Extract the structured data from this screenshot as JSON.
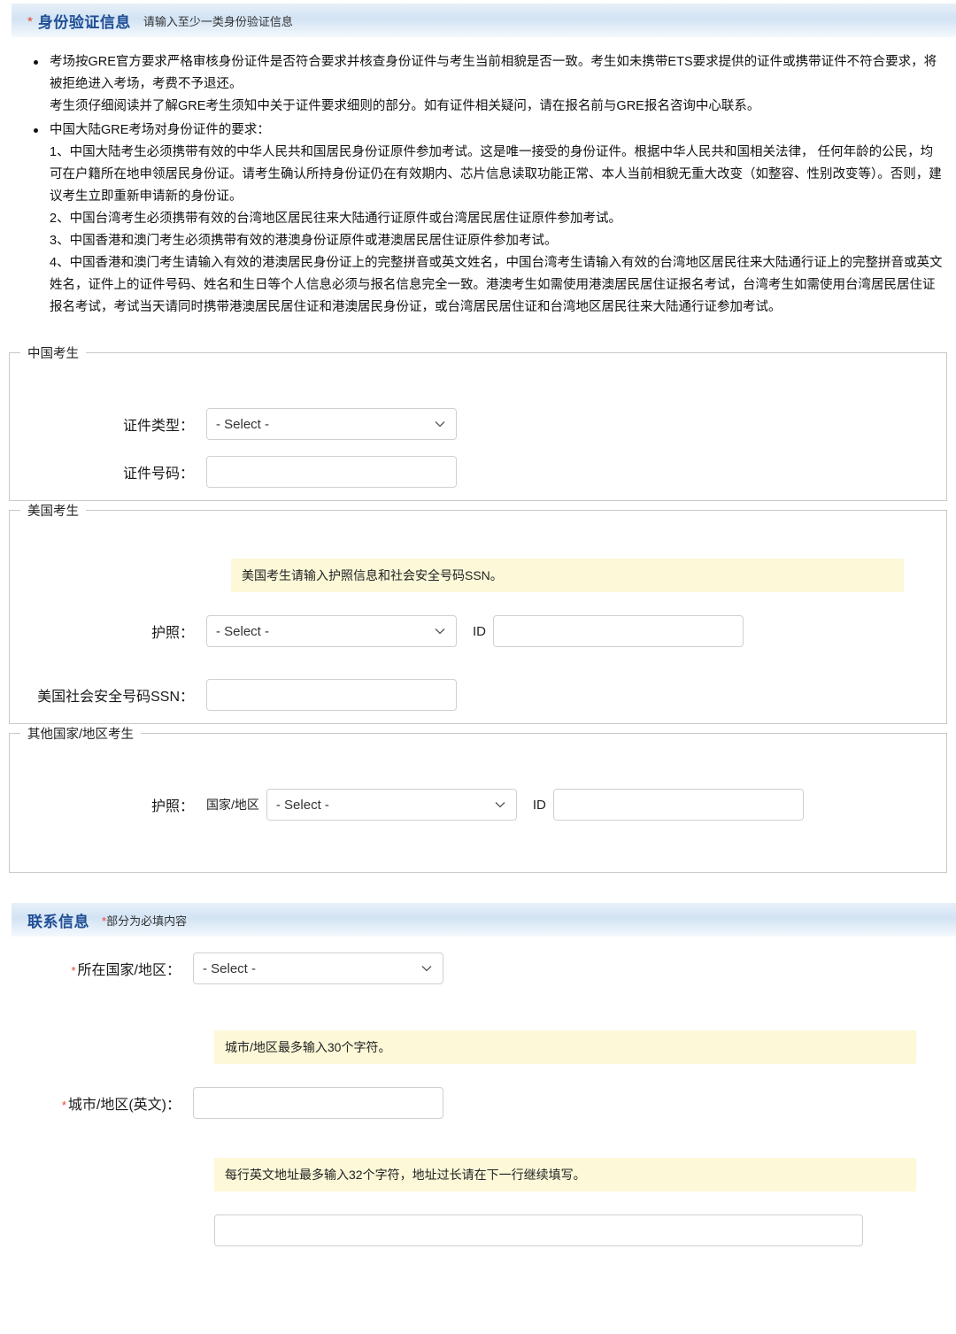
{
  "identity_section": {
    "required_star": "*",
    "title": "身份验证信息",
    "subtitle": "请输入至少一类身份验证信息",
    "notes": [
      {
        "lines": [
          "考场按GRE官方要求严格审核身份证件是否符合要求并核查身份证件与考生当前相貌是否一致。考生如未携带ETS要求提供的证件或携带证件不符合要求，将被拒绝进入考场，考费不予退还。",
          "考生须仔细阅读并了解GRE考生须知中关于证件要求细则的部分。如有证件相关疑问，请在报名前与GRE报名咨询中心联系。"
        ]
      },
      {
        "lines": [
          "中国大陆GRE考场对身份证件的要求：",
          "1、中国大陆考生必须携带有效的中华人民共和国居民身份证原件参加考试。这是唯一接受的身份证件。根据中华人民共和国相关法律， 任何年龄的公民，均可在户籍所在地申领居民身份证。请考生确认所持身份证仍在有效期内、芯片信息读取功能正常、本人当前相貌无重大改变（如整容、性别改变等）。否则，建议考生立即重新申请新的身份证。",
          "2、中国台湾考生必须携带有效的台湾地区居民往来大陆通行证原件或台湾居民居住证原件参加考试。",
          "3、中国香港和澳门考生必须携带有效的港澳身份证原件或港澳居民居住证原件参加考试。",
          "4、中国香港和澳门考生请输入有效的港澳居民身份证上的完整拼音或英文姓名，中国台湾考生请输入有效的台湾地区居民往来大陆通行证上的完整拼音或英文姓名，证件上的证件号码、姓名和生日等个人信息必须与报名信息完全一致。港澳考生如需使用港澳居民居住证报名考试，台湾考生如需使用台湾居民居住证报名考试，考试当天请同时携带港澳居民居住证和港澳居民身份证，或台湾居民居住证和台湾地区居民往来大陆通行证参加考试。"
        ]
      }
    ],
    "groups": {
      "china": {
        "legend": "中国考生",
        "id_type_label": "证件类型：",
        "id_type_value": "- Select -",
        "id_number_label": "证件号码：",
        "id_number_value": ""
      },
      "usa": {
        "legend": "美国考生",
        "hint": "美国考生请输入护照信息和社会安全号码SSN。",
        "passport_label": "护照：",
        "passport_value": "- Select -",
        "id_prefix": "ID",
        "id_value": "",
        "ssn_label": "美国社会安全号码SSN：",
        "ssn_value": ""
      },
      "other": {
        "legend": "其他国家/地区考生",
        "passport_label": "护照：",
        "country_label": "国家/地区",
        "country_value": "- Select -",
        "id_prefix": "ID",
        "id_value": ""
      }
    }
  },
  "contact_section": {
    "title": "联系信息",
    "required_star": "*",
    "subtitle": "部分为必填内容",
    "country_label": "所在国家/地区：",
    "country_value": "- Select -",
    "city_hint": "城市/地区最多输入30个字符。",
    "city_label": "城市/地区(英文)：",
    "city_value": "",
    "address_hint": "每行英文地址最多输入32个字符，地址过长请在下一行继续填写。",
    "address_value": ""
  },
  "icons": {
    "chevron_down": "chevron-down-icon"
  },
  "colors": {
    "banner_title": "#1f4e96",
    "required": "#e8422b",
    "hint_bg": "#fcf8d8",
    "field_border": "#d0d0d0"
  }
}
